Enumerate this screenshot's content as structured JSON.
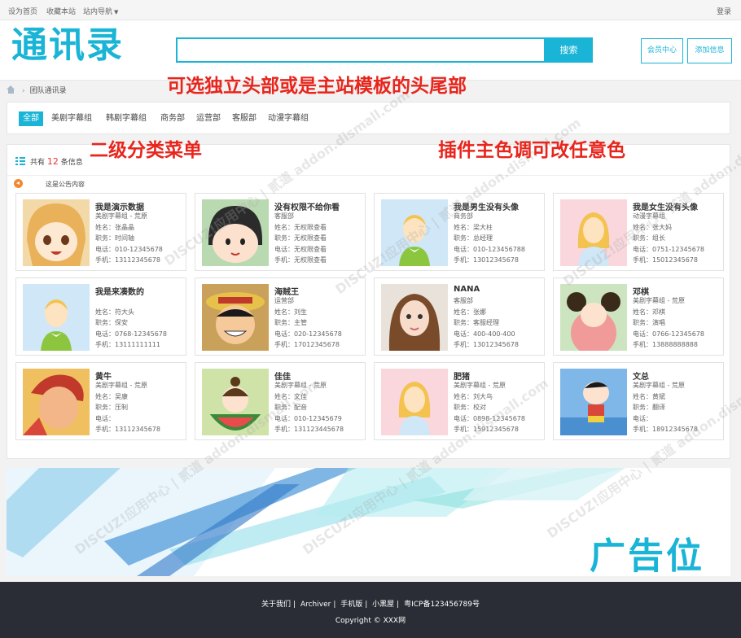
{
  "topbar": {
    "set_home": "设为首页",
    "bookmark": "收藏本站",
    "site_nav": "站内导航",
    "login": "登录"
  },
  "header": {
    "logo": "通讯录",
    "search_value": "",
    "search_label": "搜索",
    "member_center": "会员中心",
    "add_info": "添加信息"
  },
  "breadcrumb": {
    "current": "团队通讯录"
  },
  "categories": [
    {
      "label": "全部"
    },
    {
      "label": "美剧字幕组"
    },
    {
      "label": "韩剧字幕组"
    },
    {
      "label": "商务部"
    },
    {
      "label": "运营部"
    },
    {
      "label": "客服部"
    },
    {
      "label": "动漫字幕组"
    }
  ],
  "list": {
    "count_prefix": "共有",
    "count": "12",
    "count_suffix": "条信息",
    "notice": "这是公告内容"
  },
  "cards": [
    {
      "name": "我是演示数据",
      "dept": "美剧字幕组 - 荒原",
      "l1": "姓名：张晶晶",
      "l2": "职务：时间轴",
      "l3": "电话：010-12345678",
      "l4": "手机：13112345678",
      "avatar": "anime-girl-avatar"
    },
    {
      "name": "没有权限不给你看",
      "dept": "客服部",
      "l1": "姓名：无权限查看",
      "l2": "职务：无权限查看",
      "l3": "电话：无权限查看",
      "l4": "手机：无权限查看",
      "avatar": "maruko-avatar"
    },
    {
      "name": "我是男生没有头像",
      "dept": "商务部",
      "l1": "姓名：梁大柱",
      "l2": "职务：总经理",
      "l3": "电话：010-123456788",
      "l4": "手机：13012345678",
      "avatar": "default-male-avatar"
    },
    {
      "name": "我是女生没有头像",
      "dept": "动漫字幕组",
      "l1": "姓名：张大妈",
      "l2": "职务：组长",
      "l3": "电话：0751-12345678",
      "l4": "手机：15012345678",
      "avatar": "default-female-avatar"
    },
    {
      "name": "我是来凑数的",
      "dept": "",
      "l1": "姓名：符大头",
      "l2": "职务：保安",
      "l3": "电话：0768-12345678",
      "l4": "手机：13111111111",
      "avatar": "default-male-avatar"
    },
    {
      "name": "海贼王",
      "dept": "运营部",
      "l1": "姓名：刘生",
      "l2": "职务：主管",
      "l3": "电话：020-12345678",
      "l4": "手机：17012345678",
      "avatar": "luffy-avatar"
    },
    {
      "name": "NANA",
      "dept": "客服部",
      "l1": "姓名：张娜",
      "l2": "职务：客服经理",
      "l3": "电话：400-400-400",
      "l4": "手机：13012345678",
      "avatar": "photo-avatar"
    },
    {
      "name": "邓棋",
      "dept": "美剧字幕组 - 荒原",
      "l1": "姓名：邓棋",
      "l2": "职务：演唱",
      "l3": "电话：0766-12345678",
      "l4": "手机：13888888888",
      "avatar": "cartoon-girl-avatar"
    },
    {
      "name": "黄牛",
      "dept": "美剧字幕组 - 荒原",
      "l1": "姓名：吴康",
      "l2": "职务：压制",
      "l3": "电话：",
      "l4": "手机：13112345678",
      "avatar": "basketball-avatar"
    },
    {
      "name": "佳佳",
      "dept": "美剧字幕组 - 荒原",
      "l1": "姓名：文佳",
      "l2": "职务：配音",
      "l3": "电话：010-12345679",
      "l4": "手机：131123445678",
      "avatar": "watermelon-girl-avatar"
    },
    {
      "name": "肥猪",
      "dept": "美剧字幕组 - 荒原",
      "l1": "姓名：刘大鸟",
      "l2": "职务：校对",
      "l3": "电话：0898-12345678",
      "l4": "手机：15912345678",
      "avatar": "default-female-avatar"
    },
    {
      "name": "文总",
      "dept": "美剧字幕组 - 荒原",
      "l1": "姓名：黄斌",
      "l2": "职务：翻译",
      "l3": "电话：",
      "l4": "手机：18912345678",
      "avatar": "shinchan-avatar"
    }
  ],
  "ad": {
    "text": "广告位"
  },
  "footer": {
    "about": "关于我们",
    "archiver": "Archiver",
    "mobile": "手机版",
    "blackroom": "小黑屋",
    "icp": "粤ICP备123456789号",
    "copyright": "Copyright © XXX网"
  },
  "annotations": {
    "header": "可选独立头部或是主站模板的头尾部",
    "menu": "二级分类菜单",
    "color": "插件主色调可改任意色"
  },
  "watermark": "DISCUZ!应用中心 | 贰道 addon.dismall.com",
  "colors": {
    "accent": "#19b4d6",
    "annotation": "#e8251c",
    "footer_bg": "#2a2d35",
    "count": "#ee3333"
  }
}
